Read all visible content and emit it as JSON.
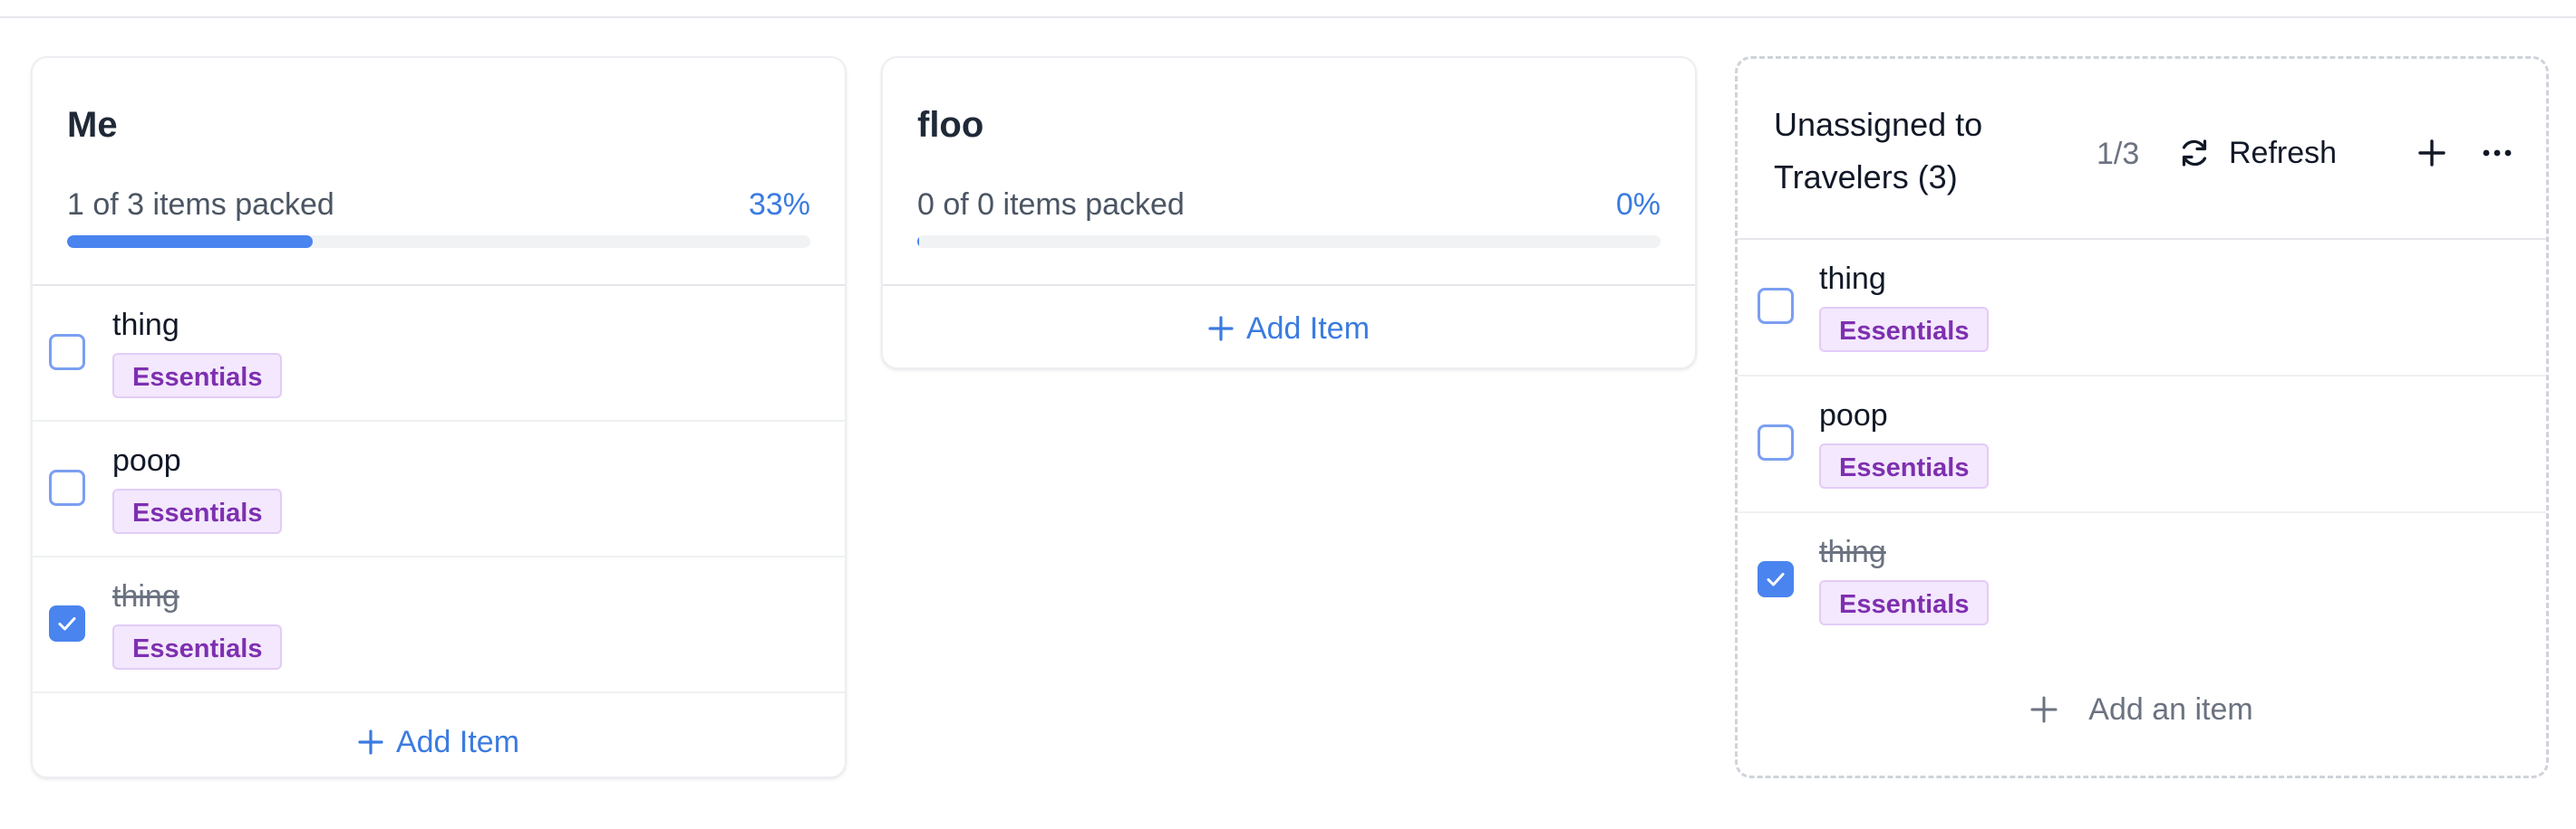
{
  "columns": {
    "me": {
      "title": "Me",
      "progress_label": "1 of 3 items packed",
      "progress_pct": "33%",
      "progress_value": 0.33,
      "items": [
        {
          "name": "thing",
          "tag": "Essentials",
          "checked": false
        },
        {
          "name": "poop",
          "tag": "Essentials",
          "checked": false
        },
        {
          "name": "thing",
          "tag": "Essentials",
          "checked": true
        }
      ],
      "add_label": "Add Item"
    },
    "floo": {
      "title": "floo",
      "progress_label": "0 of 0 items packed",
      "progress_pct": "0%",
      "progress_value": 0,
      "items": [],
      "add_label": "Add Item"
    },
    "unassigned": {
      "title": "Unassigned to Travelers (3)",
      "page_count": "1/3",
      "refresh_label": "Refresh",
      "items": [
        {
          "name": "thing",
          "tag": "Essentials",
          "checked": false
        },
        {
          "name": "poop",
          "tag": "Essentials",
          "checked": false
        },
        {
          "name": "thing",
          "tag": "Essentials",
          "checked": true
        }
      ],
      "add_label": "Add an item"
    }
  },
  "icons": {
    "refresh": "refresh-icon",
    "plus": "plus-icon",
    "more": "more-horizontal-icon",
    "check": "check-icon"
  },
  "colors": {
    "accent": "#4a84ef",
    "link": "#3b7be0",
    "tag_text": "#7e2fb0",
    "tag_bg": "#f3e8fd"
  }
}
